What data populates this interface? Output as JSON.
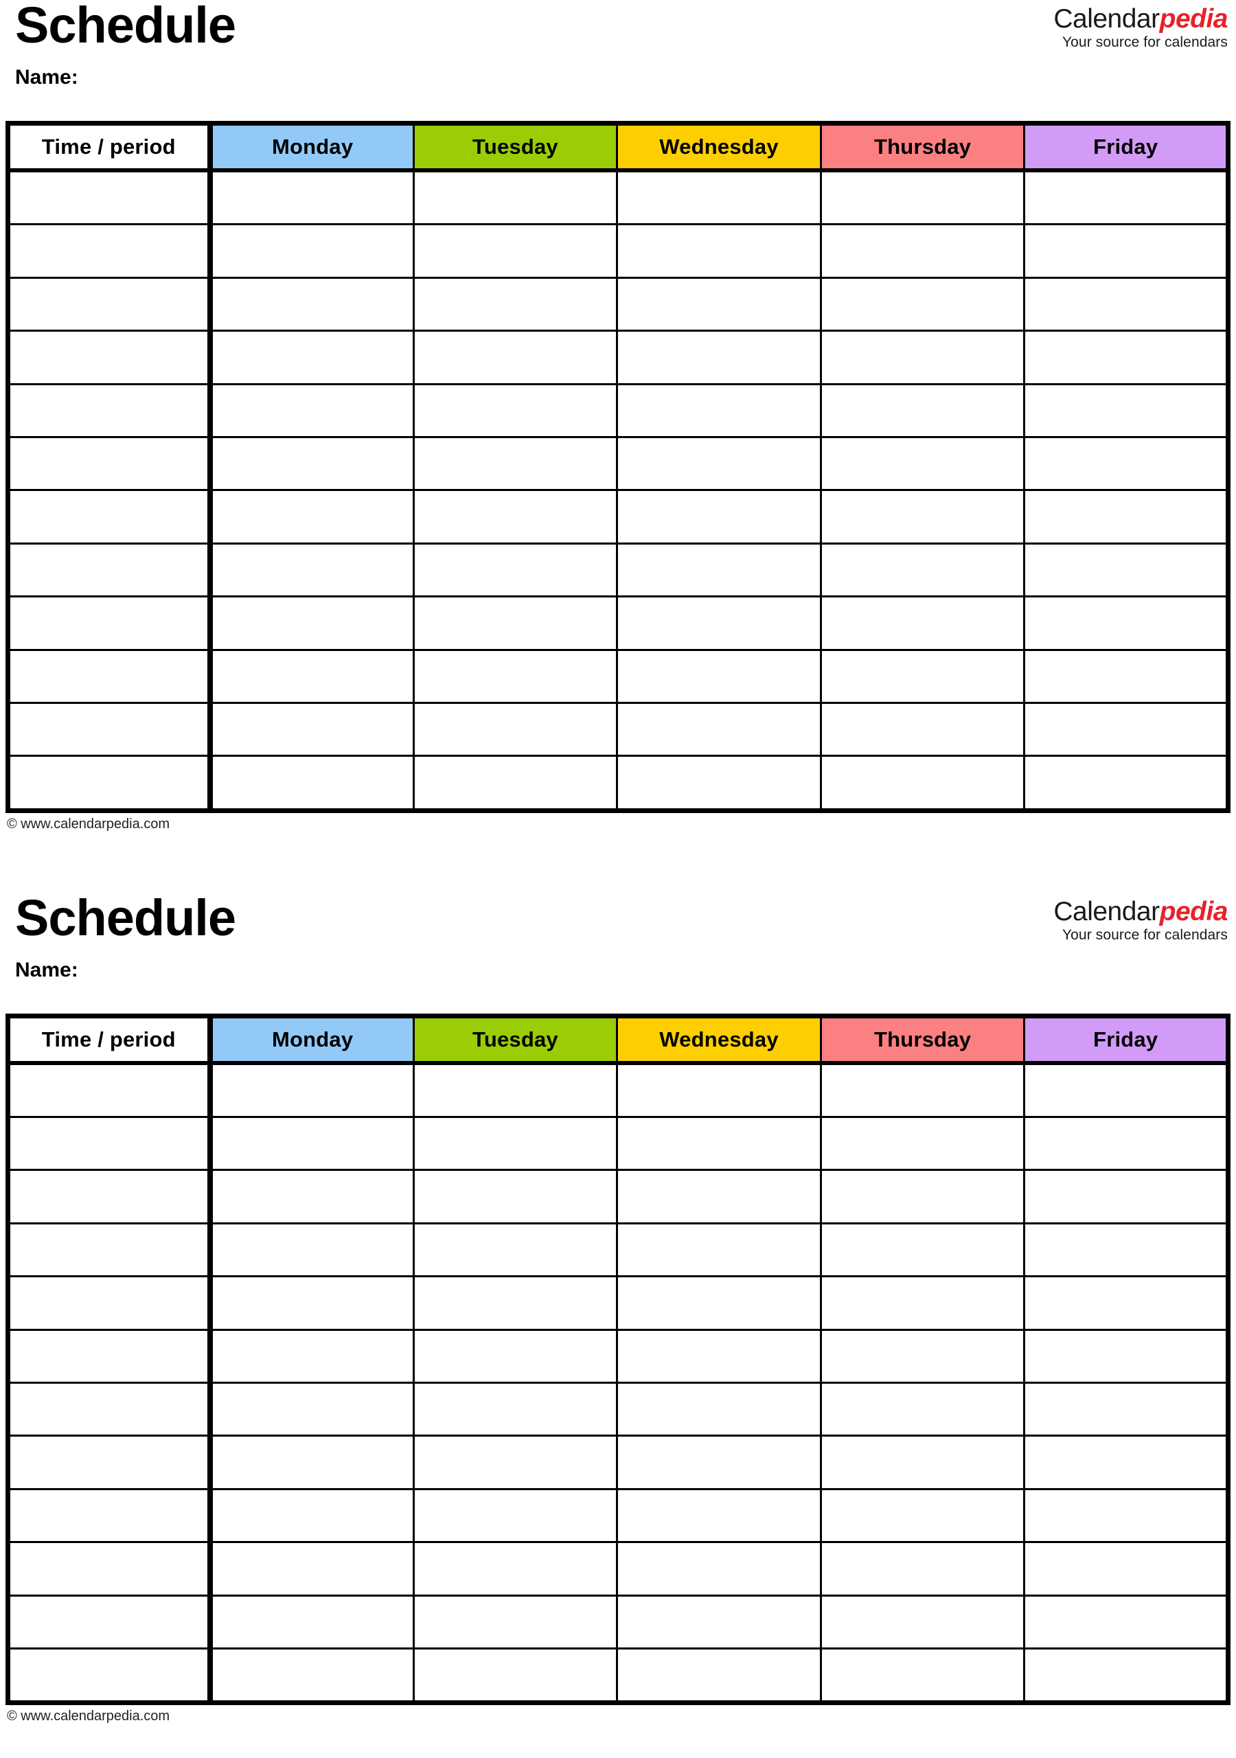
{
  "document": {
    "title": "Schedule",
    "page_type": "weekly-schedule-template",
    "blocks_count": 2
  },
  "brand": {
    "logo_primary": "Calendar",
    "logo_accent": "pedia",
    "tagline": "Your source for calendars",
    "accent_color": "#e8212a",
    "primary_color": "#1a1a1a"
  },
  "block1": {
    "title": "Schedule",
    "name_label": "Name:",
    "copyright": "© www.calendarpedia.com"
  },
  "block2": {
    "title": "Schedule",
    "name_label": "Name:",
    "copyright": "© www.calendarpedia.com"
  },
  "table": {
    "columns": [
      {
        "label": "Time / period",
        "key": "time",
        "bg": "#ffffff"
      },
      {
        "label": "Monday",
        "key": "monday",
        "bg": "#93c9f7"
      },
      {
        "label": "Tuesday",
        "key": "tuesday",
        "bg": "#9acd05"
      },
      {
        "label": "Wednesday",
        "key": "wednesday",
        "bg": "#fecf00"
      },
      {
        "label": "Thursday",
        "key": "thursday",
        "bg": "#fa8081"
      },
      {
        "label": "Friday",
        "key": "friday",
        "bg": "#d29bf7"
      }
    ],
    "body_row_count": 12,
    "rows": [
      {
        "time": "",
        "monday": "",
        "tuesday": "",
        "wednesday": "",
        "thursday": "",
        "friday": ""
      },
      {
        "time": "",
        "monday": "",
        "tuesday": "",
        "wednesday": "",
        "thursday": "",
        "friday": ""
      },
      {
        "time": "",
        "monday": "",
        "tuesday": "",
        "wednesday": "",
        "thursday": "",
        "friday": ""
      },
      {
        "time": "",
        "monday": "",
        "tuesday": "",
        "wednesday": "",
        "thursday": "",
        "friday": ""
      },
      {
        "time": "",
        "monday": "",
        "tuesday": "",
        "wednesday": "",
        "thursday": "",
        "friday": ""
      },
      {
        "time": "",
        "monday": "",
        "tuesday": "",
        "wednesday": "",
        "thursday": "",
        "friday": ""
      },
      {
        "time": "",
        "monday": "",
        "tuesday": "",
        "wednesday": "",
        "thursday": "",
        "friday": ""
      },
      {
        "time": "",
        "monday": "",
        "tuesday": "",
        "wednesday": "",
        "thursday": "",
        "friday": ""
      },
      {
        "time": "",
        "monday": "",
        "tuesday": "",
        "wednesday": "",
        "thursday": "",
        "friday": ""
      },
      {
        "time": "",
        "monday": "",
        "tuesday": "",
        "wednesday": "",
        "thursday": "",
        "friday": ""
      },
      {
        "time": "",
        "monday": "",
        "tuesday": "",
        "wednesday": "",
        "thursday": "",
        "friday": ""
      },
      {
        "time": "",
        "monday": "",
        "tuesday": "",
        "wednesday": "",
        "thursday": "",
        "friday": ""
      }
    ]
  }
}
